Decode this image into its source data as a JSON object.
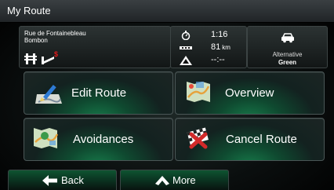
{
  "window": {
    "title": "My Route"
  },
  "route": {
    "address_line1": "Rue de Fontainebleau",
    "address_line2": "Bombon",
    "signs": [
      "highway-icon",
      "toll-road-icon"
    ]
  },
  "stats": {
    "time": "1:16",
    "distance_value": "81",
    "distance_unit": "km",
    "warning_value": "--:--"
  },
  "route_alternative": {
    "label": "Alternative",
    "value": "Green",
    "icon": "car-icon"
  },
  "menu": {
    "edit_route": "Edit Route",
    "overview": "Overview",
    "avoidances": "Avoidances",
    "cancel_route": "Cancel Route"
  },
  "bottom_bar": {
    "back": "Back",
    "more": "More"
  },
  "colors": {
    "accent_green": "#177a4a",
    "title_bar": "#2e3336",
    "cancel_red": "#d22a2a"
  }
}
